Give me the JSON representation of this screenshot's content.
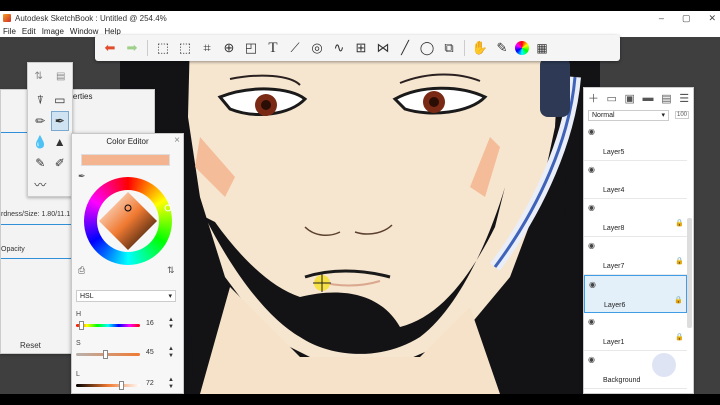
{
  "window": {
    "title": "Autodesk SketchBook : Untitled @ 254.4%",
    "controls": [
      "–",
      "▢",
      "✕"
    ]
  },
  "menu": [
    "File",
    "Edit",
    "Image",
    "Window",
    "Help"
  ],
  "toolbar": {
    "tools": [
      "undo-icon",
      "redo-icon",
      "selection-icon",
      "transform-selection-icon",
      "crop-icon",
      "add-layer-icon",
      "distort-icon",
      "text-icon",
      "ruler-icon",
      "ellipse-guide-icon",
      "french-curve-icon",
      "perspective-icon",
      "symmetry-icon",
      "line-icon",
      "shape-icon",
      "copic-icon",
      "brushes-icon",
      "color-wheel-icon",
      "palette-icon"
    ]
  },
  "brush_properties": {
    "title": "operties",
    "size_label": "rdness/Size: 1.80/11.1",
    "opacity_label": "Opacity",
    "reset_label": "Reset",
    "accent_color": "#2f8fd8"
  },
  "color_editor": {
    "title": "Color Editor",
    "close": "×",
    "current_color": "#f3b48f",
    "mode": "HSL",
    "sliders": [
      {
        "label": "H",
        "value": "16",
        "fraction": 0.05
      },
      {
        "label": "S",
        "value": "45",
        "fraction": 0.45
      },
      {
        "label": "L",
        "value": "72",
        "fraction": 0.72
      }
    ]
  },
  "layers": {
    "blend_mode": "Normal",
    "opacity_badge": "100",
    "items": [
      {
        "name": "Layer5",
        "locked": false,
        "selected": false
      },
      {
        "name": "Layer4",
        "locked": false,
        "selected": false
      },
      {
        "name": "Layer8",
        "locked": true,
        "selected": false
      },
      {
        "name": "Layer7",
        "locked": true,
        "selected": false
      },
      {
        "name": "Layer6",
        "locked": true,
        "selected": true
      },
      {
        "name": "Layer1",
        "locked": true,
        "selected": false
      },
      {
        "name": "Background",
        "locked": false,
        "selected": false
      }
    ]
  },
  "colors": {
    "skin": "#f7e6cf",
    "blush": "#f3b48f",
    "hair": "#131316",
    "eye": "#7a2a14",
    "headphone": "#3f63b8"
  }
}
